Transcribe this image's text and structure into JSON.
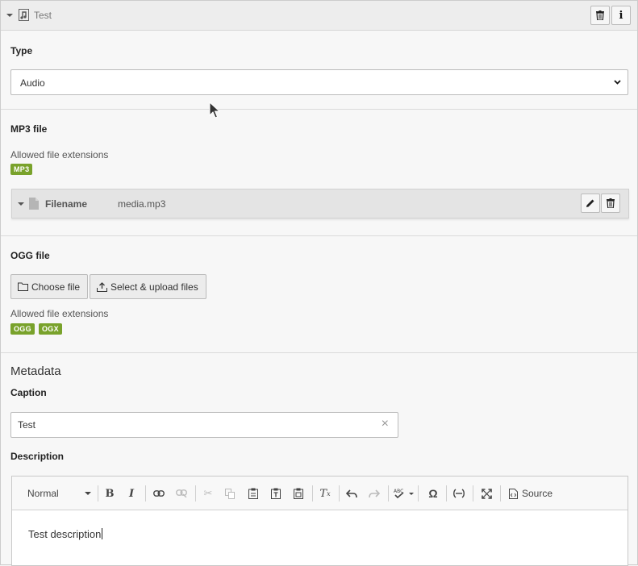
{
  "header": {
    "title": "Test",
    "delete_icon": "trash-icon",
    "info_icon": "info-icon"
  },
  "type_section": {
    "label": "Type",
    "selected": "Audio"
  },
  "mp3_section": {
    "label": "MP3 file",
    "allowed_label": "Allowed file extensions",
    "extensions": [
      "MP3"
    ],
    "file": {
      "label": "Filename",
      "name": "media.mp3"
    }
  },
  "ogg_section": {
    "label": "OGG file",
    "choose_label": "Choose file",
    "upload_label": "Select & upload files",
    "allowed_label": "Allowed file extensions",
    "extensions": [
      "OGG",
      "OGX"
    ]
  },
  "metadata": {
    "title": "Metadata",
    "caption_label": "Caption",
    "caption_value": "Test",
    "description_label": "Description",
    "editor": {
      "format": "Normal",
      "source_label": "Source",
      "content": "Test description"
    }
  }
}
